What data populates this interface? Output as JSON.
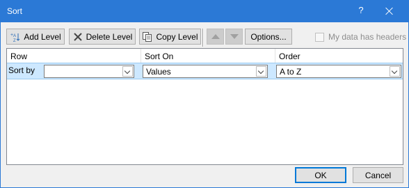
{
  "window": {
    "title": "Sort",
    "help_label": "?"
  },
  "toolbar": {
    "add_level": "Add Level",
    "delete_level": "Delete Level",
    "copy_level": "Copy Level",
    "options": "Options...",
    "move_up_icon": "arrow-up-icon",
    "move_down_icon": "arrow-down-icon",
    "my_data_has_headers": "My data has headers",
    "my_data_has_headers_checked": false
  },
  "grid": {
    "columns": [
      "Row",
      "Sort On",
      "Order"
    ],
    "rows": [
      {
        "label": "Sort by",
        "row_value": "",
        "sort_on": "Values",
        "order": "A to Z"
      }
    ]
  },
  "footer": {
    "ok": "OK",
    "cancel": "Cancel"
  },
  "colors": {
    "titlebar": "#2b79d6",
    "selected_row": "#cde8ff",
    "ok_border": "#0078d7"
  }
}
